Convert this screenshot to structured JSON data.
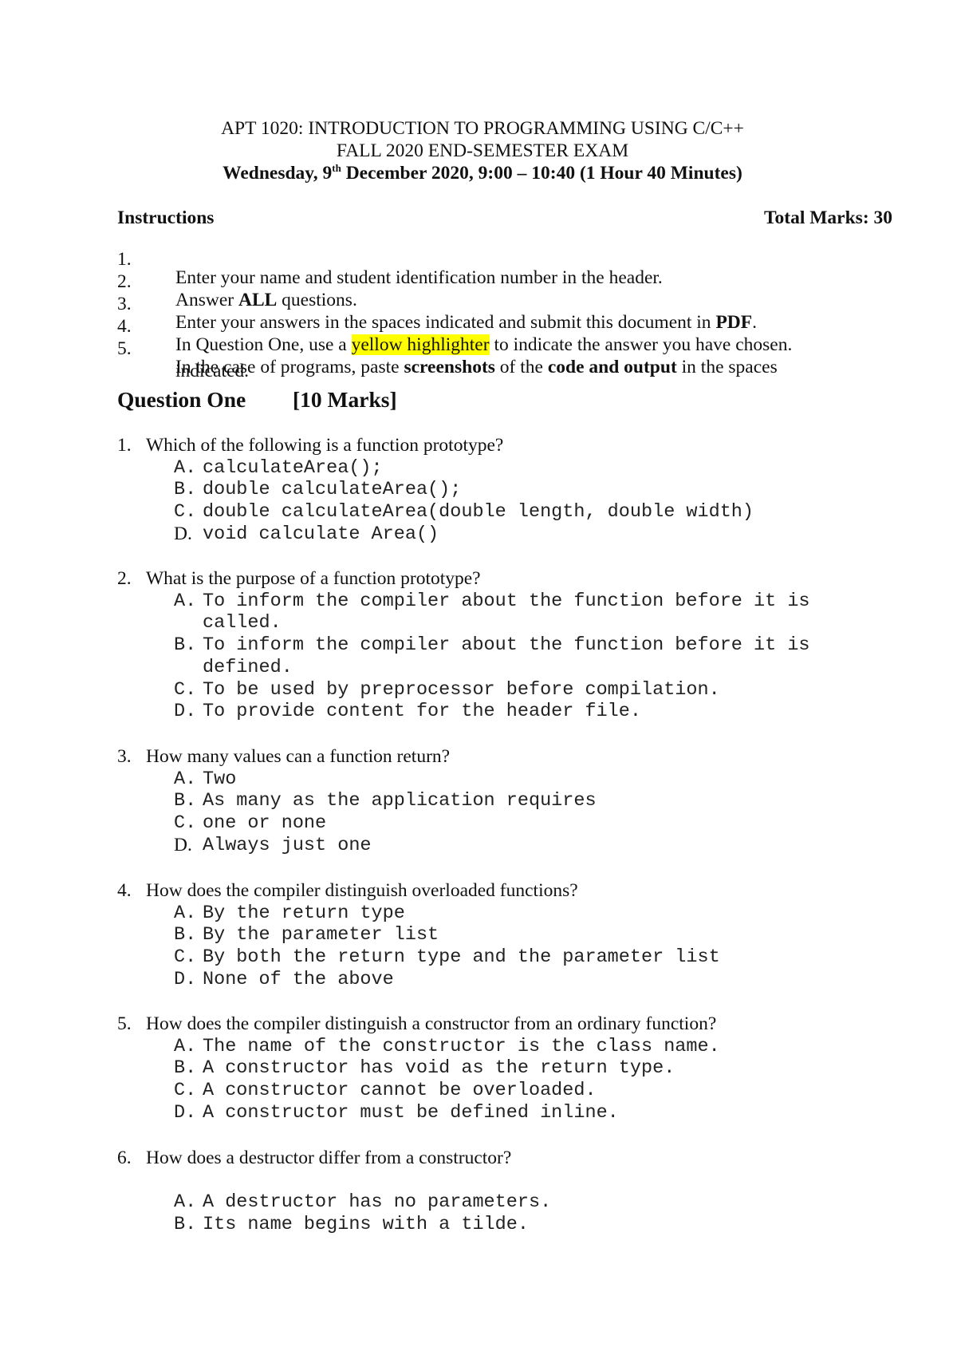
{
  "header": {
    "course_title": "APT 1020: INTRODUCTION TO PROGRAMMING USING C/C++",
    "exam_title": "FALL 2020 END-SEMESTER EXAM",
    "date_prefix": "Wednesday, 9",
    "date_sup": "th",
    "date_suffix": " December 2020, 9:00 – 10:40 (1 Hour 40 Minutes)"
  },
  "instructions": {
    "heading": "Instructions",
    "total_marks": "Total Marks: 30",
    "items": [
      {
        "num": "1.",
        "text": "Enter your name and student identification number in the header."
      },
      {
        "num": "2.",
        "pre": "Answer ",
        "bold": "ALL",
        "post": " questions."
      },
      {
        "num": "3.",
        "pre": "Enter your answers in the spaces indicated and submit this document in ",
        "bold": "PDF",
        "post": "."
      },
      {
        "num": "4.",
        "pre": "In Question One, use a ",
        "highlight": "yellow highlighter",
        "post": " to indicate the answer you have chosen.",
        "highlight_color": "#ffff00"
      },
      {
        "num": "5.",
        "pre": "In the case of programs, paste ",
        "bold1": "screenshots",
        "mid": " of the ",
        "bold2": "code and output",
        "post": " in the spaces",
        "continuation": "indicated."
      }
    ]
  },
  "section": {
    "title": "Question One",
    "marks": "[10 Marks]"
  },
  "questions": [
    {
      "num": "1.",
      "text": "Which of the following is a function prototype?",
      "options": [
        {
          "letter": "A.",
          "text": "calculateArea();"
        },
        {
          "letter": "B.",
          "text": "double calculateArea();"
        },
        {
          "letter": "C.",
          "text": "double calculateArea(double length, double width)"
        },
        {
          "letter": "D.",
          "text": "void calculate Area()"
        }
      ]
    },
    {
      "num": "2.",
      "text": "What is the purpose of a function prototype?",
      "options": [
        {
          "letter": "A.",
          "text": "To inform the compiler about the function before it is",
          "wrap": "called."
        },
        {
          "letter": "B.",
          "text": "To inform the compiler about the function before it is",
          "wrap": "defined."
        },
        {
          "letter": "C.",
          "text": "To be used by preprocessor before compilation."
        },
        {
          "letter": "D.",
          "text": "To provide content for the header file."
        }
      ]
    },
    {
      "num": "3.",
      "text": "How many values can a function return?",
      "options": [
        {
          "letter": "A.",
          "text": "Two"
        },
        {
          "letter": "B.",
          "text": "As many as the application requires"
        },
        {
          "letter": "C.",
          "text": "one or none"
        },
        {
          "letter": "D.",
          "text": "Always just one"
        }
      ]
    },
    {
      "num": "4.",
      "text": "How does the compiler distinguish overloaded functions?",
      "options": [
        {
          "letter": "A.",
          "text": "By the return type"
        },
        {
          "letter": "B.",
          "text": "By the parameter list"
        },
        {
          "letter": "C.",
          "text": "By both the return type and the parameter list"
        },
        {
          "letter": "D.",
          "text": "None of the above"
        }
      ]
    },
    {
      "num": "5.",
      "text": "How does the compiler distinguish a constructor from an ordinary function?",
      "options": [
        {
          "letter": "A.",
          "text": "The name of the constructor is the class name."
        },
        {
          "letter": "B.",
          "text": "A constructor has void as the return type."
        },
        {
          "letter": "C.",
          "text": "A constructor cannot be overloaded."
        },
        {
          "letter": "D.",
          "text": "A constructor must be defined inline."
        }
      ]
    },
    {
      "num": "6.",
      "text": "How does a destructor differ from a constructor?",
      "options": [
        {
          "letter": "A.",
          "text": "A destructor has no parameters."
        },
        {
          "letter": "B.",
          "text": "Its name begins with a tilde."
        }
      ]
    }
  ]
}
